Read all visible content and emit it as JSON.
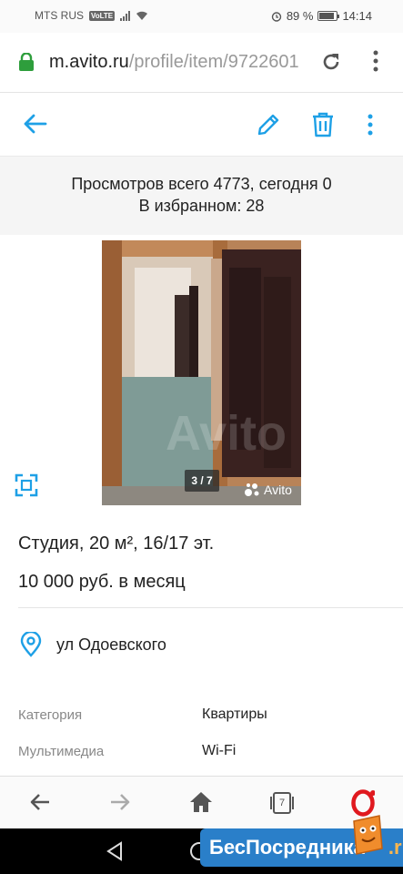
{
  "status_bar": {
    "carrier": "MTS RUS",
    "volte": "VoLTE",
    "battery_percent": "89 %",
    "battery_level": 0.89,
    "time": "14:14"
  },
  "browser": {
    "url_host": "m.avito.ru",
    "url_path": "/profile/item/9722601",
    "reload_icon": "reload-icon",
    "menu_icon": "more-vert-icon"
  },
  "toolbar": {
    "back_icon": "arrow-left-icon",
    "edit_icon": "pencil-icon",
    "delete_icon": "trash-icon",
    "more_icon": "more-vert-icon"
  },
  "stats": {
    "views": "Просмотров всего 4773, сегодня 0",
    "favorites": "В избранном: 28"
  },
  "gallery": {
    "counter": "3 / 7",
    "watermark": "Avito",
    "fullscreen_icon": "fullscreen-icon"
  },
  "listing": {
    "title": "Студия, 20 м², 16/17 эт.",
    "price": "10 000 руб. в месяц",
    "address": "ул Одоевского"
  },
  "params": [
    {
      "key": "Категория",
      "value": "Квартиры"
    },
    {
      "key": "Мультимедиа",
      "value": "Wi-Fi"
    }
  ],
  "bottom_nav": {
    "tab_count": "7",
    "icons": [
      "back-icon",
      "forward-icon",
      "home-icon",
      "tabs-icon",
      "opera-icon"
    ]
  },
  "overlay": {
    "badge_text": "БесПосредника",
    "badge_suffix": ".ru"
  },
  "colors": {
    "accent": "#1ea0e6",
    "lock": "#2e9e3c",
    "opera": "#e0191f",
    "badge": "#2a7fc9"
  }
}
